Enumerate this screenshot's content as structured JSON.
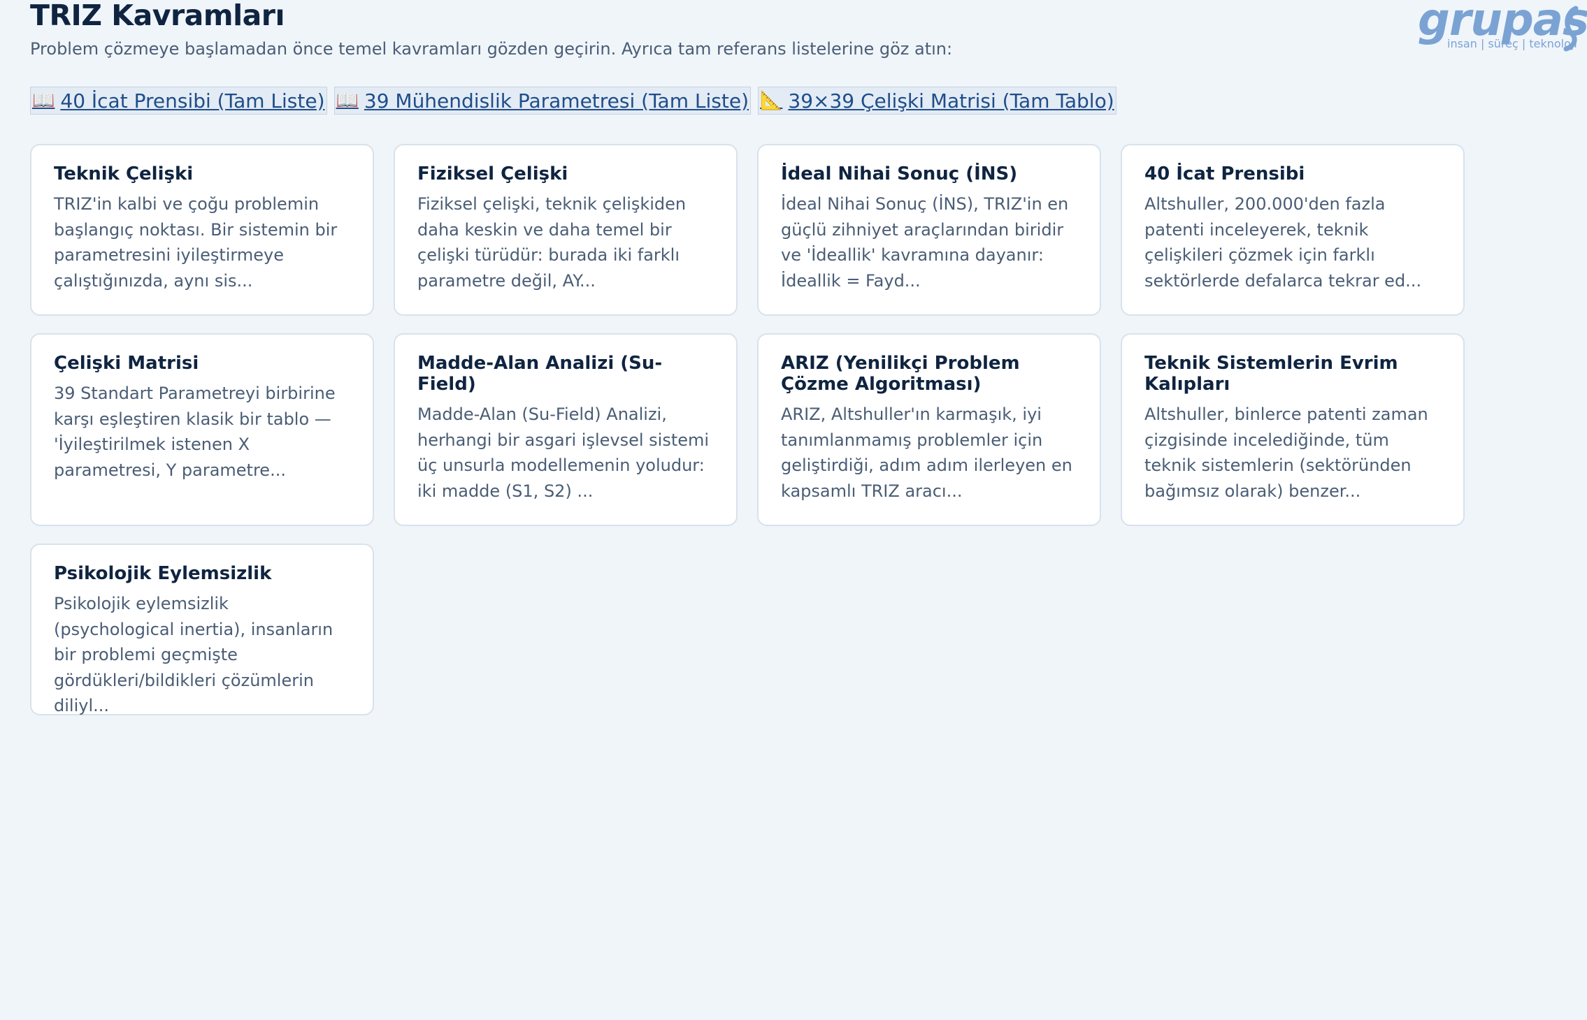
{
  "header": {
    "title": "TRIZ Kavramları",
    "subtitle": "Problem çözmeye başlamadan önce temel kavramları gözden geçirin. Ayrıca tam referans listelerine göz atın:"
  },
  "logo": {
    "word": "grupas",
    "tagline": "insan | süreç | teknoloji",
    "color": "#7aa3d3"
  },
  "ref_links": [
    {
      "icon": "📖",
      "icon_name": "book-icon",
      "label": "40 İcat Prensibi (Tam Liste)"
    },
    {
      "icon": "📖",
      "icon_name": "book-icon",
      "label": "39 Mühendislik Parametresi (Tam Liste)"
    },
    {
      "icon": "📐",
      "icon_name": "triangle-ruler-icon",
      "label": "39×39 Çelişki Matrisi (Tam Tablo)"
    }
  ],
  "cards": [
    {
      "title": "Teknik Çelişki",
      "text": "TRIZ'in kalbi ve çoğu problemin başlangıç noktası. Bir sistemin bir parametresini iyileştirmeye çalıştığınızda, aynı sis..."
    },
    {
      "title": "Fiziksel Çelişki",
      "text": "Fiziksel çelişki, teknik çelişkiden daha keskin ve daha temel bir çelişki türüdür: burada iki farklı parametre değil, AY..."
    },
    {
      "title": "İdeal Nihai Sonuç (İNS)",
      "text": "İdeal Nihai Sonuç (İNS), TRIZ'in en güçlü zihniyet araçlarından biridir ve 'İdeallik' kavramına dayanır: İdeallik = Fayd..."
    },
    {
      "title": "40 İcat Prensibi",
      "text": "Altshuller, 200.000'den fazla patenti inceleyerek, teknik çelişkileri çözmek için farklı sektörlerde defalarca tekrar ed..."
    },
    {
      "title": "Çelişki Matrisi",
      "text": "39 Standart Parametreyi birbirine karşı eşleştiren klasik bir tablo — 'İyileştirilmek istenen X parametresi, Y parametre..."
    },
    {
      "title": "Madde-Alan Analizi (Su-Field)",
      "text": "Madde-Alan (Su-Field) Analizi, herhangi bir asgari işlevsel sistemi üç unsurla modellemenin yoludur: iki madde (S1, S2) ..."
    },
    {
      "title": "ARIZ (Yenilikçi Problem Çözme Algoritması)",
      "text": "ARIZ, Altshuller'ın karmaşık, iyi tanımlanmamış problemler için geliştirdiği, adım adım ilerleyen en kapsamlı TRIZ aracı..."
    },
    {
      "title": "Teknik Sistemlerin Evrim Kalıpları",
      "text": "Altshuller, binlerce patenti zaman çizgisinde incelediğinde, tüm teknik sistemlerin (sektöründen bağımsız olarak) benzer..."
    },
    {
      "title": "Psikolojik Eylemsizlik",
      "text": "Psikolojik eylemsizlik (psychological inertia), insanların bir problemi geçmişte gördükleri/bildikleri çözümlerin diliyl..."
    }
  ]
}
